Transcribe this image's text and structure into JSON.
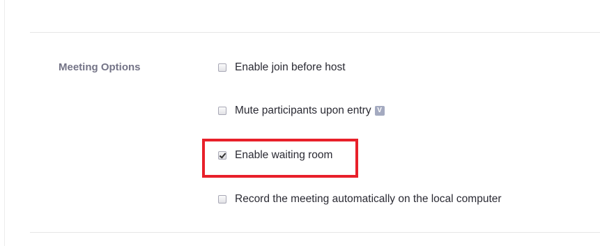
{
  "section": {
    "label": "Meeting Options"
  },
  "options": [
    {
      "label": "Enable join before host",
      "checked": false
    },
    {
      "label": "Mute participants upon entry",
      "checked": false,
      "info_icon": {
        "name": "info-icon",
        "glyph": "V"
      }
    },
    {
      "label": "Enable waiting room",
      "checked": true,
      "highlighted": true
    },
    {
      "label": "Record the meeting automatically on the local computer",
      "checked": false
    }
  ],
  "colors": {
    "highlight_border": "#e8202a",
    "label_text": "#747487",
    "option_text": "#2a2a33",
    "info_icon_bg": "#a4aac0"
  }
}
